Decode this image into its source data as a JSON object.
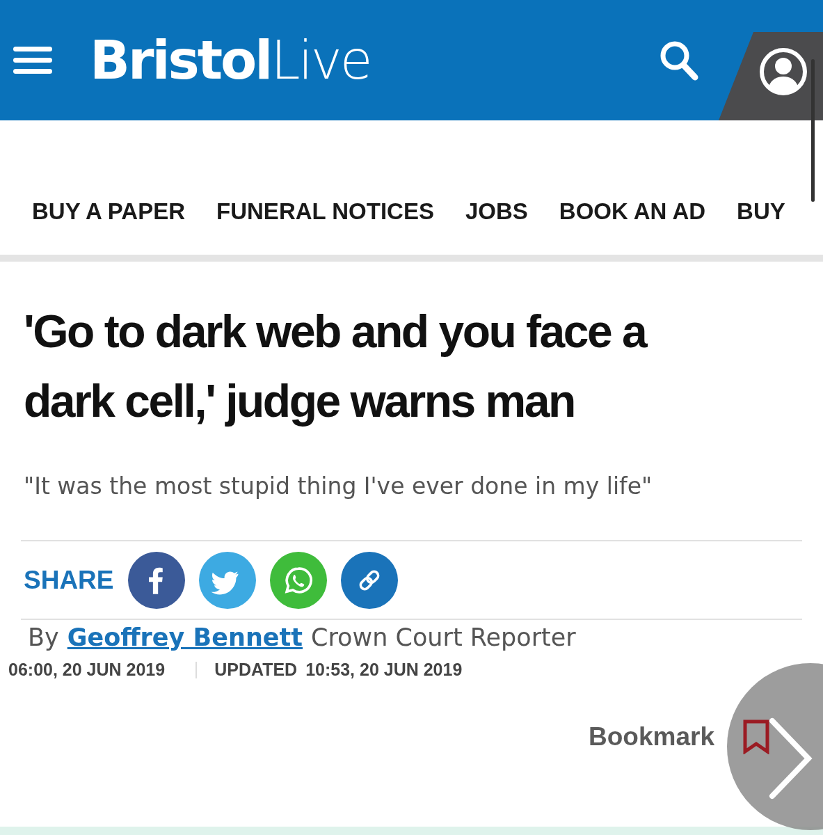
{
  "header": {
    "logo": "**Bristol**Live"
  },
  "nav": [
    {
      "label": "BUY A PAPER"
    },
    {
      "label": "FUNERAL NOTICES"
    },
    {
      "label": "JOBS"
    },
    {
      "label": "BOOK AN AD"
    },
    {
      "label": "BUY"
    }
  ],
  "article": {
    "headline": "'Go to dark web and you face a dark cell,' judge warns man",
    "standfirst": "\"It was the most stupid thing I've ever done in my life\"",
    "share_label": "SHARE",
    "share_buttons": [
      {
        "kind": "facebook"
      },
      {
        "kind": "twitter"
      },
      {
        "kind": "whatsapp"
      },
      {
        "kind": "link"
      }
    ],
    "byline": {
      "prefix": "By",
      "author": "Geoffrey Bennett",
      "role": "Crown Court Reporter"
    },
    "published": "06:00, 20 JUN 2019",
    "updated_label": "UPDATED",
    "updated": "10:53, 20 JUN 2019",
    "bookmark": "Bookmark"
  }
}
